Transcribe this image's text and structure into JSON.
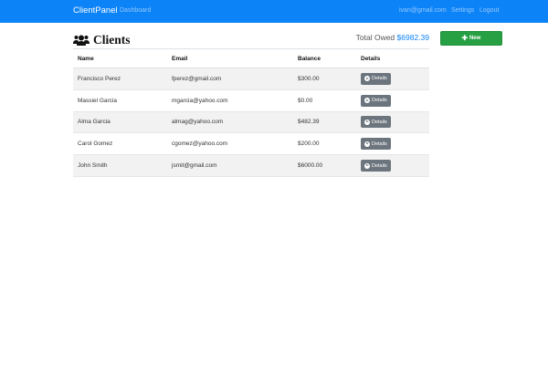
{
  "navbar": {
    "brand": "ClientPanel",
    "dashboard": "Dashboard",
    "email": "ivan@gmail.com",
    "settings": "Settings",
    "logout": "Logout",
    "bg_color": "#0d83f8"
  },
  "header": {
    "title": "Clients",
    "title_icon": "users-icon",
    "total_owed_label": "Total Owed",
    "total_owed_value": "$6982.39",
    "new_button": "New",
    "new_button_icon": "plus-icon",
    "new_button_color": "#27a043"
  },
  "table": {
    "columns": [
      "Name",
      "Email",
      "Balance",
      "Details"
    ],
    "details_label": "Details",
    "details_icon": "arrow-circle-right-icon",
    "rows": [
      {
        "name": "Francisco Perez",
        "email": "fperez@gmail.com",
        "balance": "$300.00"
      },
      {
        "name": "Massiel Garcia",
        "email": "mgarcia@yahoo.com",
        "balance": "$0.00"
      },
      {
        "name": "Alma Garcia",
        "email": "almag@yahoo.com",
        "balance": "$482.39"
      },
      {
        "name": "Carol Gomez",
        "email": "cgomez@yahoo.com",
        "balance": "$200.00"
      },
      {
        "name": "John Smith",
        "email": "jsmit@gmail.com",
        "balance": "$6000.00"
      }
    ]
  }
}
